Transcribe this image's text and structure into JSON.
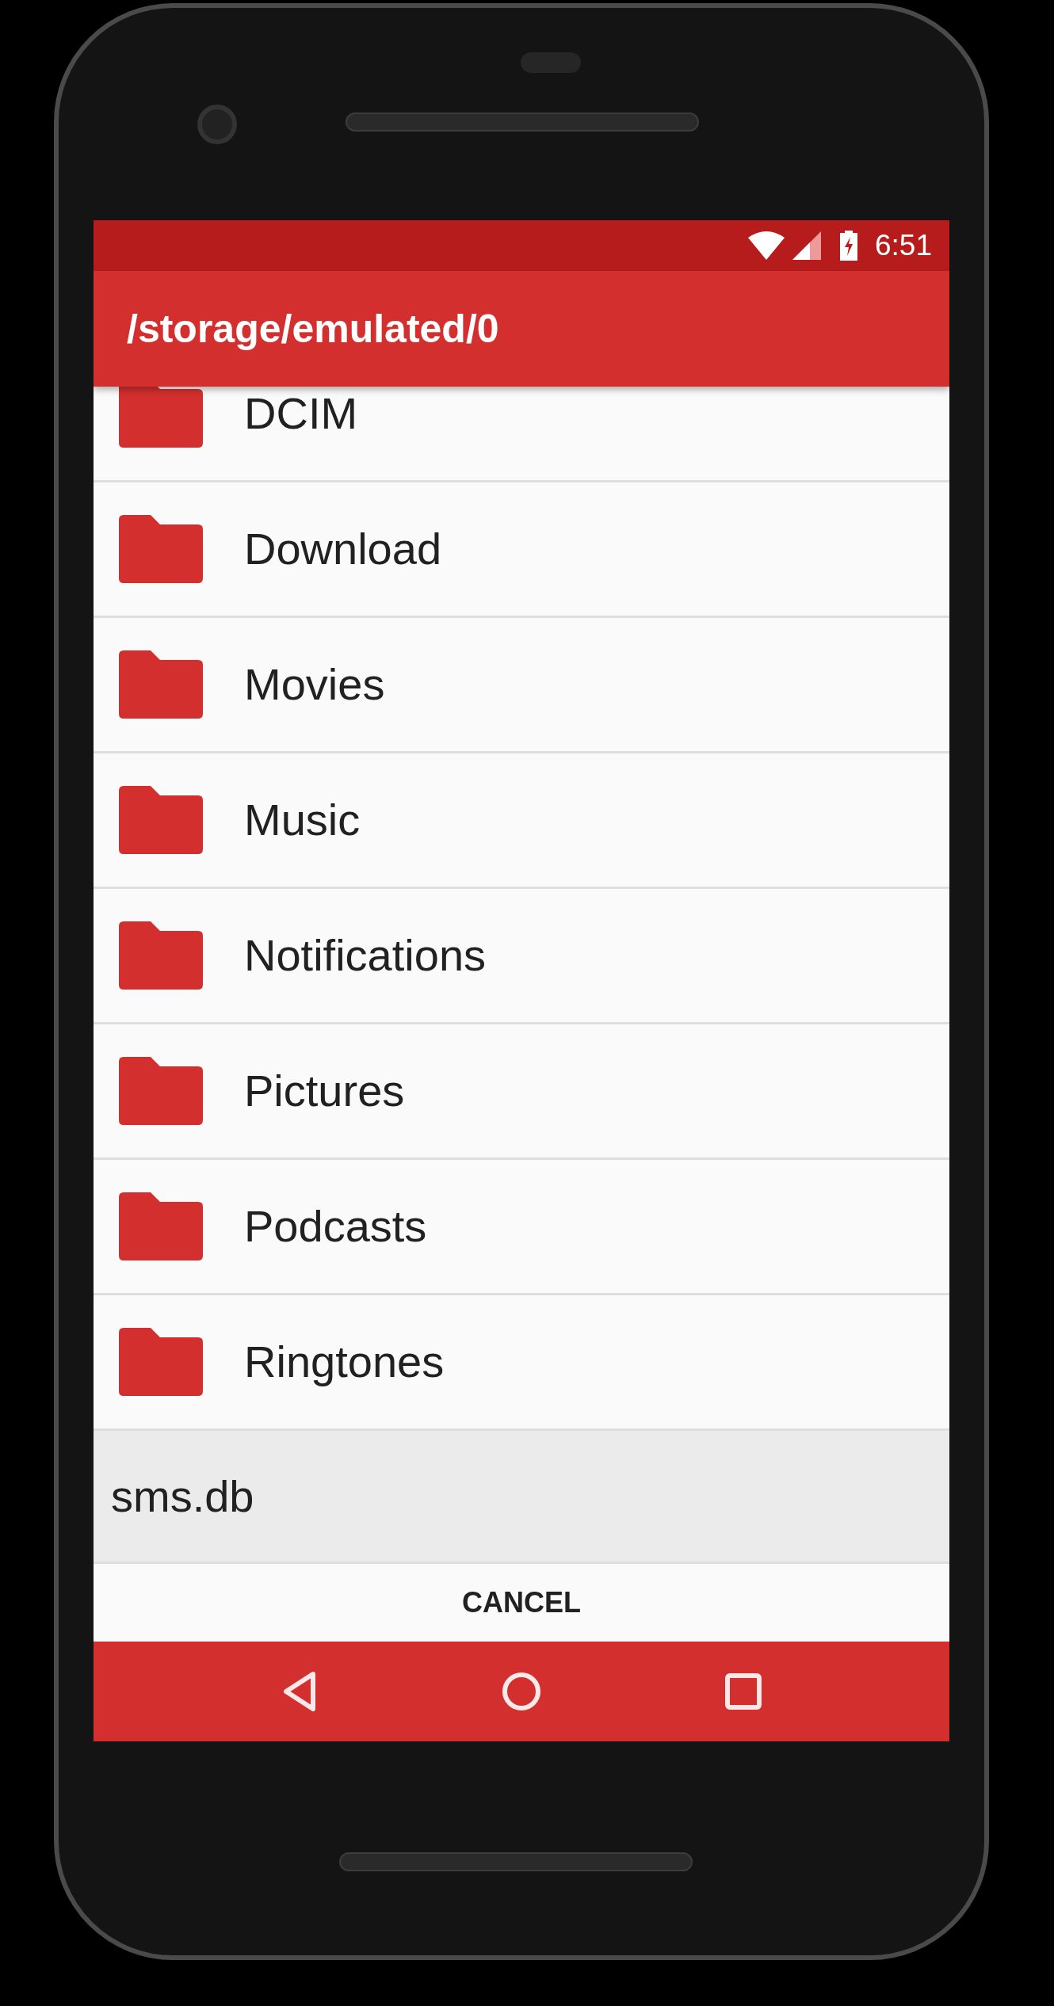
{
  "status_bar": {
    "time": "6:51"
  },
  "app_bar": {
    "title": "/storage/emulated/0"
  },
  "files": [
    {
      "name": "DCIM",
      "kind": "folder",
      "selected": false
    },
    {
      "name": "Download",
      "kind": "folder",
      "selected": false
    },
    {
      "name": "Movies",
      "kind": "folder",
      "selected": false
    },
    {
      "name": "Music",
      "kind": "folder",
      "selected": false
    },
    {
      "name": "Notifications",
      "kind": "folder",
      "selected": false
    },
    {
      "name": "Pictures",
      "kind": "folder",
      "selected": false
    },
    {
      "name": "Podcasts",
      "kind": "folder",
      "selected": false
    },
    {
      "name": "Ringtones",
      "kind": "folder",
      "selected": false
    },
    {
      "name": "sms.db",
      "kind": "file",
      "selected": true
    }
  ],
  "dialog_buttons": [
    "CANCEL"
  ]
}
